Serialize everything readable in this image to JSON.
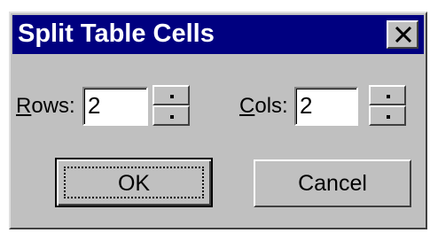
{
  "dialog": {
    "title": "Split Table Cells",
    "close_icon": "close-icon"
  },
  "rows": {
    "label_mnemonic": "R",
    "label_rest": "ows:",
    "value": "2"
  },
  "cols": {
    "label_mnemonic": "C",
    "label_rest": "ols:",
    "value": "2"
  },
  "buttons": {
    "ok_label": "OK",
    "cancel_label": "Cancel"
  },
  "colors": {
    "titlebar": "#000080",
    "face": "#c0c0c0"
  }
}
